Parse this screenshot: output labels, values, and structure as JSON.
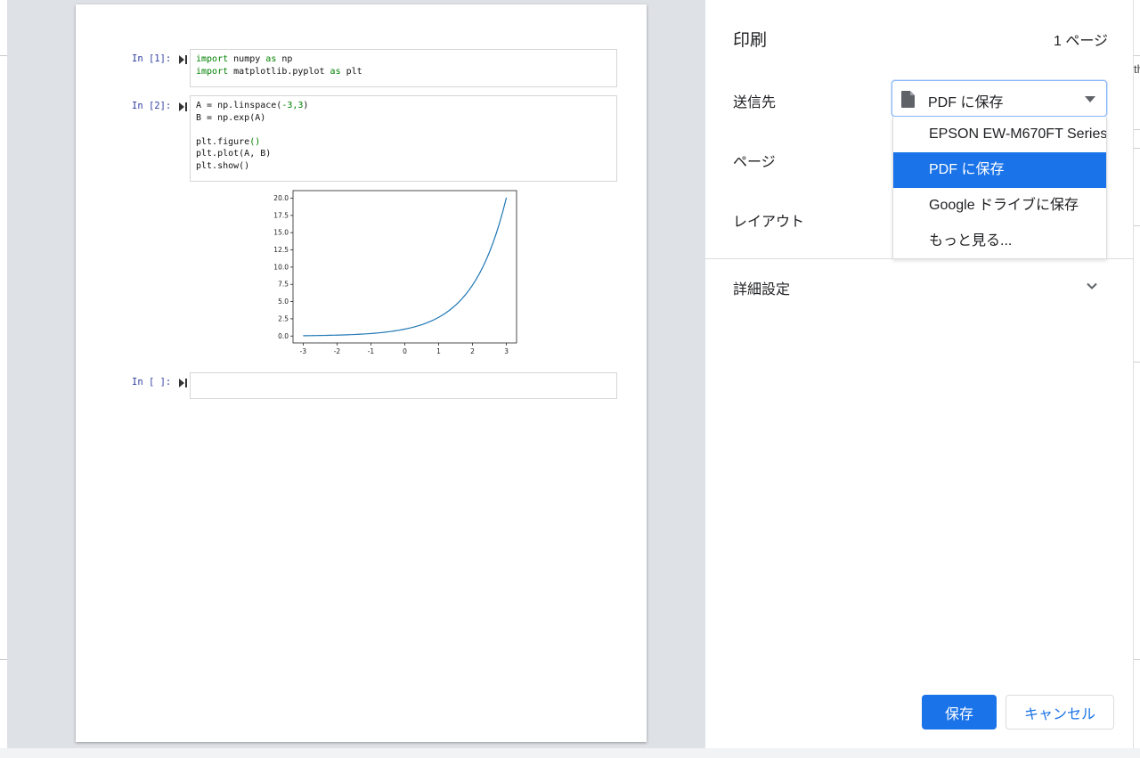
{
  "dialog": {
    "title": "印刷",
    "page_count": "1 ページ",
    "destination": {
      "label": "送信先",
      "selected": "PDF に保存",
      "icon": "file-icon",
      "options": [
        {
          "label": "EPSON EW-M670FT Series",
          "active": false
        },
        {
          "label": "PDF に保存",
          "active": true
        },
        {
          "label": "Google ドライブに保存",
          "active": false
        },
        {
          "label": "もっと見る...",
          "active": false
        }
      ]
    },
    "pages_label": "ページ",
    "layout_label": "レイアウト",
    "advanced_label": "詳細設定",
    "save_button": "保存",
    "cancel_button": "キャンセル",
    "accent_color": "#1a73e8"
  },
  "background": {
    "right_clip_text": "th"
  },
  "notebook": {
    "cells": [
      {
        "prompt": "In [1]:",
        "lines": [
          "import numpy as np",
          "import matplotlib.pyplot as plt"
        ]
      },
      {
        "prompt": "In [2]:",
        "lines": [
          "A = np.linspace(-3,3)",
          "B = np.exp(A)",
          "",
          "plt.figure()",
          "plt.plot(A, B)",
          "plt.show()"
        ]
      },
      {
        "prompt": "In [ ]:",
        "lines": []
      }
    ]
  },
  "chart_data": {
    "type": "line",
    "function": "exp(x)",
    "x_range": [
      -3,
      3
    ],
    "x_ticks": [
      "-3",
      "-2",
      "-1",
      "0",
      "1",
      "2",
      "3"
    ],
    "y_ticks": [
      "0.0",
      "2.5",
      "5.0",
      "7.5",
      "10.0",
      "12.5",
      "15.0",
      "17.5",
      "20.0"
    ],
    "xlim": [
      -3.3,
      3.3
    ],
    "ylim": [
      -1.0,
      21.1
    ],
    "series": [
      {
        "color": "#1f77b4",
        "x": [
          -3,
          -2.5,
          -2,
          -1.5,
          -1,
          -0.5,
          0,
          0.5,
          1,
          1.5,
          2,
          2.25,
          2.5,
          2.75,
          3
        ],
        "y": [
          0.05,
          0.08,
          0.14,
          0.22,
          0.37,
          0.61,
          1.0,
          1.65,
          2.72,
          4.48,
          7.39,
          9.49,
          12.18,
          15.64,
          20.09
        ]
      }
    ],
    "grid": false
  }
}
